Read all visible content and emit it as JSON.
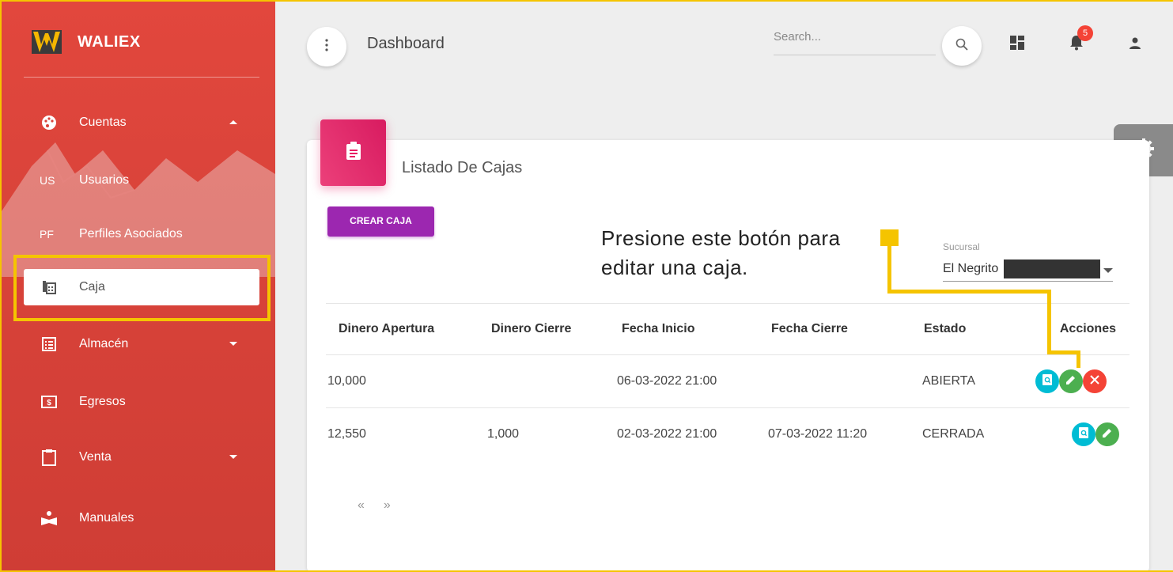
{
  "app": {
    "name": "WALIEX"
  },
  "sidebar": {
    "items": [
      {
        "label": "Cuentas",
        "icon": "palette-icon",
        "expanded": true
      },
      {
        "label": "Usuarios",
        "abbr": "US"
      },
      {
        "label": "Perfiles Asociados",
        "abbr": "PF"
      },
      {
        "label": "Caja",
        "icon": "calculator-icon",
        "active": true
      },
      {
        "label": "Almacén",
        "icon": "list-icon",
        "expanded": false
      },
      {
        "label": "Egresos",
        "icon": "money-icon"
      },
      {
        "label": "Venta",
        "icon": "clipboard-icon",
        "expanded": false
      },
      {
        "label": "Manuales",
        "icon": "reader-icon"
      }
    ]
  },
  "header": {
    "title": "Dashboard",
    "search_placeholder": "Search...",
    "notification_count": "5"
  },
  "card": {
    "title": "Listado De Cajas",
    "create_button": "CREAR CAJA",
    "callout": "Presione este botón para editar una caja.",
    "select": {
      "label": "Sucursal",
      "value": "El Negrito"
    },
    "columns": [
      "Dinero Apertura",
      "Dinero Cierre",
      "Fecha Inicio",
      "Fecha Cierre",
      "Estado",
      "Acciones"
    ],
    "rows": [
      {
        "apertura": "10,000",
        "cierre": "",
        "inicio": "06-03-2022 21:00",
        "fin": "",
        "estado": "ABIERTA"
      },
      {
        "apertura": "12,550",
        "cierre": "1,000",
        "inicio": "02-03-2022 21:00",
        "fin": "07-03-2022 11:20",
        "estado": "CERRADA"
      }
    ],
    "pager": {
      "prev": "«",
      "next": "»"
    }
  },
  "colors": {
    "sidebar": "#d9433a",
    "accent": "#9c27b0",
    "card_icon": "#e91e63",
    "highlight": "#f5c400"
  }
}
